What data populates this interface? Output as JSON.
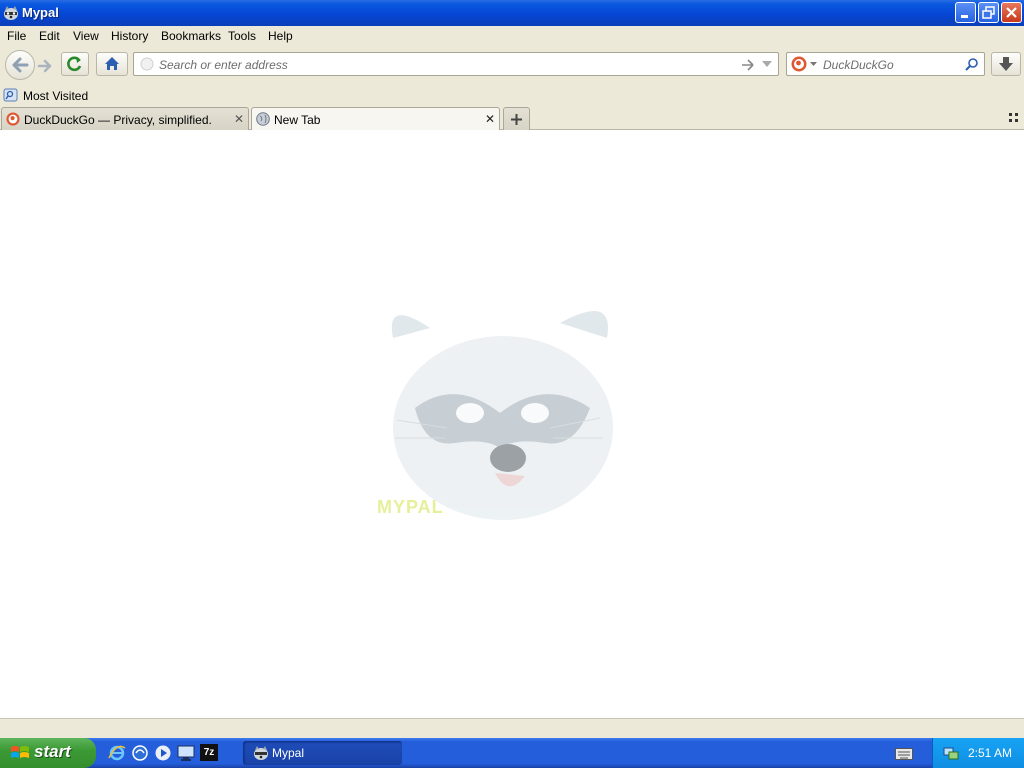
{
  "window": {
    "title": "Mypal",
    "icon": "raccoon-icon",
    "controls": [
      "minimize-icon",
      "restore-icon",
      "close-icon"
    ]
  },
  "menubar": {
    "items": [
      {
        "label": "File"
      },
      {
        "label": "Edit"
      },
      {
        "label": "View"
      },
      {
        "label": "History"
      },
      {
        "label": "Bookmarks"
      },
      {
        "label": "Tools"
      },
      {
        "label": "Help"
      }
    ]
  },
  "toolbar": {
    "address_placeholder": "Search or enter address",
    "search_engine": "DuckDuckGo",
    "search_placeholder": "DuckDuckGo"
  },
  "bookmarks": {
    "items": [
      {
        "label": "Most Visited"
      }
    ]
  },
  "tabs": [
    {
      "label": "DuckDuckGo — Privacy, simplified.",
      "active": false,
      "icon": "duckduckgo-icon"
    },
    {
      "label": "New Tab",
      "active": true,
      "icon": "globe-icon"
    }
  ],
  "content": {
    "logo_text": "MYPAL"
  },
  "taskbar": {
    "start_label": "start",
    "quicklaunch": [
      "ie-icon",
      "firefox-icon",
      "media-player-icon",
      "desktop-icon",
      "7zip-icon"
    ],
    "quicklaunch_7z_text": "7z",
    "windows": [
      {
        "label": "Mypal",
        "icon": "raccoon-icon"
      }
    ],
    "clock": "2:51 AM"
  },
  "colors": {
    "titlebar": "#0a58e0",
    "taskbar": "#245edb",
    "start_green": "#3c9a36",
    "tray": "#0f8ee3"
  }
}
